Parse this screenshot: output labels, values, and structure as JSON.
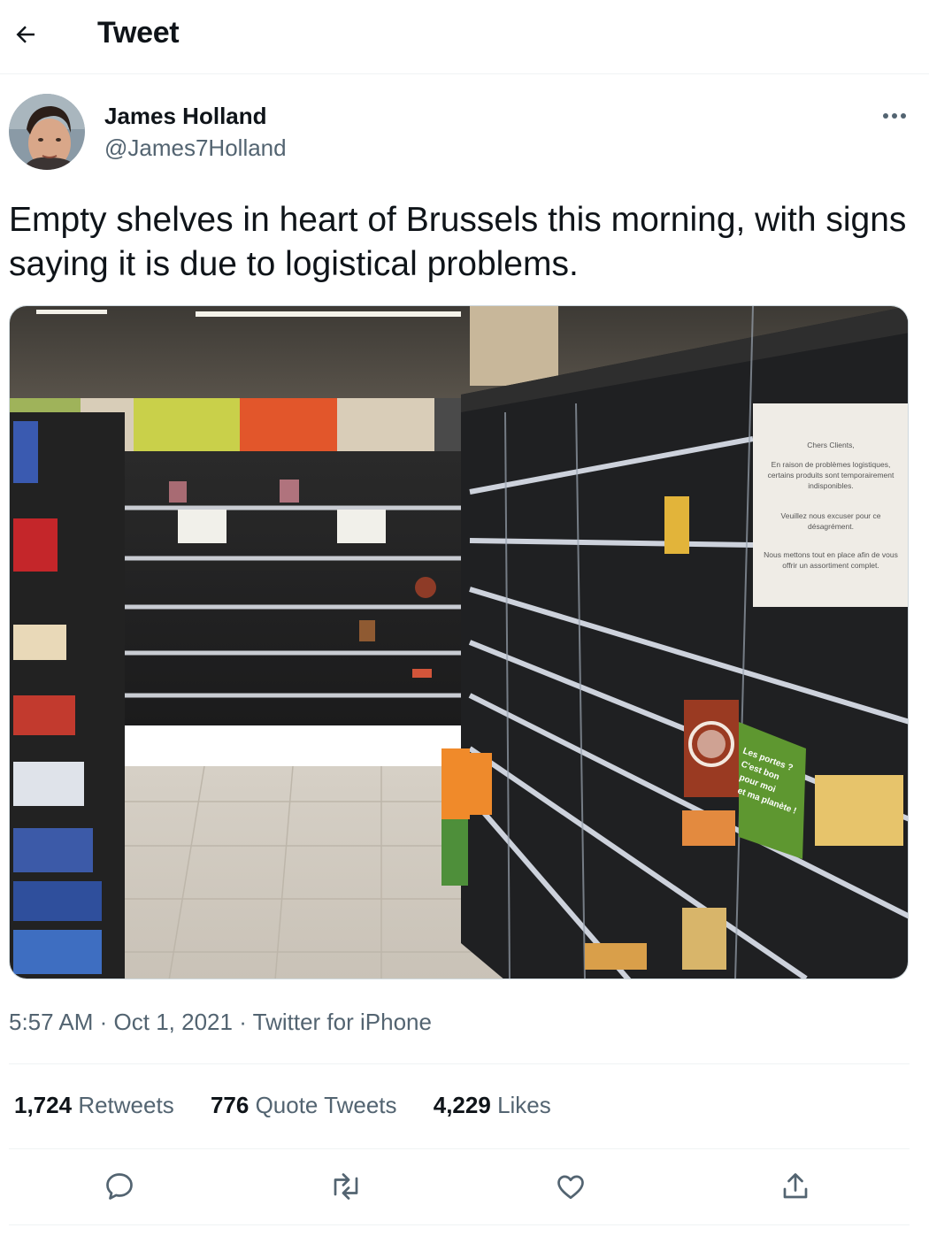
{
  "header": {
    "title": "Tweet",
    "back_icon": "arrow-left-icon"
  },
  "author": {
    "name": "James Holland",
    "handle": "@James7Holland"
  },
  "tweet": {
    "text": "Empty shelves in heart of Brussels this morning, with signs saying it is due to logistical problems.",
    "photo": {
      "sign_main": [
        "Chers Clients,",
        "En raison de problèmes logistiques,",
        "certains produits sont temporairement",
        "indisponibles.",
        "Veuillez nous excuser pour ce",
        "désagrément.",
        "Nous mettons tout en place afin de vous",
        "offrir un assortiment complet."
      ],
      "sign_green": [
        "Les portes ?",
        "C'est bon",
        "pour moi",
        "et ma planète !"
      ]
    }
  },
  "meta": {
    "time": "5:57 AM",
    "sep": "·",
    "date": "Oct 1, 2021",
    "source": "Twitter for iPhone"
  },
  "stats": {
    "retweets_count": "1,724",
    "retweets_label": "Retweets",
    "quotes_count": "776",
    "quotes_label": "Quote Tweets",
    "likes_count": "4,229",
    "likes_label": "Likes"
  },
  "actions": [
    "reply-icon",
    "retweet-icon",
    "like-icon",
    "share-icon"
  ],
  "colors": {
    "text": "#0f1419",
    "secondary": "#536471",
    "divider": "#eff3f4"
  }
}
